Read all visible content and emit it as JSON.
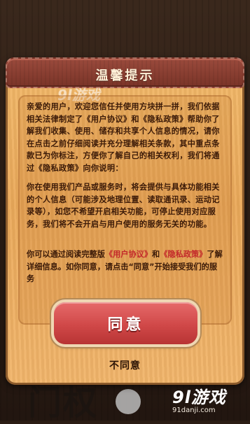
{
  "dialog": {
    "title": "温馨提示",
    "paragraph1": "亲爱的用户，欢迎您信任并使用方块拼一拼，我们依据相关法律制定了《用户协议》和《隐私政策》帮助你了解我们收集、使用、储存和共享个人信息的情况，请你在点击之前仔细阅读并充分理解相关条款，其中重点条款已为你标注，方便你了解自己的相关权利，我们将通过《隐私政策》向你说明：",
    "paragraph2": "你在使用我们产品或服务时，将会提供与具体功能相关的个人信息（可能涉及地理位置、读取通讯录、运动记录等），如您不希望开启相关功能，可停止使用对应服务，我们将不会开启与用户使用的服务无关的功能。",
    "note_prefix": "你可以通过阅读完整版",
    "note_link1": "《用户协议》",
    "note_and": "和",
    "note_link2": "《隐私政策》",
    "note_suffix": "了解详细信息。如你同意，请点击“同意”开始接受我们的服务",
    "agree_label": "同意",
    "disagree_label": "不同意"
  },
  "watermark": {
    "logo": "9l游戏",
    "url": "91danji.com",
    "top_text": "9l游戏"
  },
  "background": {
    "title_text": "门权",
    "accent": "#c3282a"
  }
}
